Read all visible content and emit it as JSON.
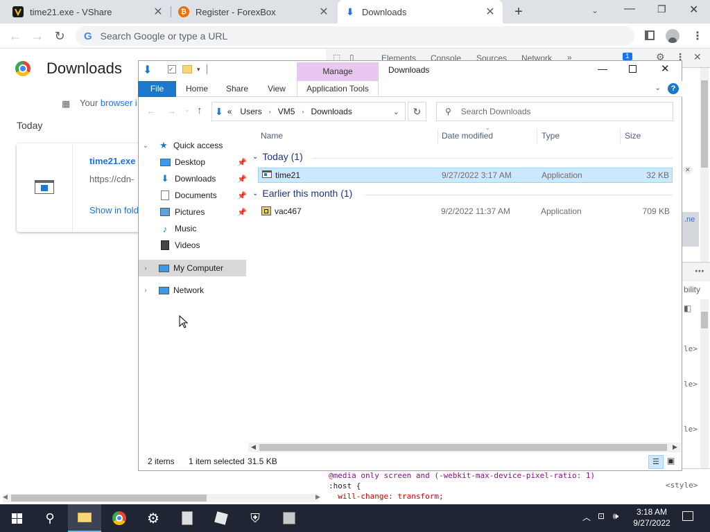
{
  "browser": {
    "tabs": [
      {
        "title": "time21.exe - VShare",
        "active": false
      },
      {
        "title": "Register - ForexBox",
        "active": false
      },
      {
        "title": "Downloads",
        "active": true
      }
    ],
    "new_tab_glyph": "+",
    "omnibox_placeholder": "Search Google or type a URL"
  },
  "downloads_page": {
    "title": "Downloads",
    "managed_prefix": "Your",
    "managed_link": "browser i",
    "today_label": "Today",
    "item": {
      "filename": "time21.exe",
      "url": "https://cdn-",
      "show_in_folder": "Show in fold"
    }
  },
  "devtools": {
    "tabs": [
      "Elements",
      "Console",
      "Sources",
      "Network"
    ],
    "more": "»",
    "issues_count": "1",
    "code_lines": [
      "@media only screen and (-webkit-max-device-pixel-ratio: 1)",
      ":host {",
      "  will-change: transform;"
    ],
    "style_tag": "<style>",
    "side_labels": [
      ".ne",
      "bility",
      "le>",
      "le>",
      "le>"
    ]
  },
  "explorer": {
    "window_title": "Downloads",
    "context_tab": "Manage",
    "ribbon_tabs": [
      "File",
      "Home",
      "Share",
      "View",
      "Application Tools"
    ],
    "address_path": [
      "«",
      "Users",
      "VM5",
      "Downloads"
    ],
    "search_placeholder": "Search Downloads",
    "nav": {
      "quick_access": "Quick access",
      "items": [
        "Desktop",
        "Downloads",
        "Documents",
        "Pictures",
        "Music",
        "Videos"
      ],
      "my_computer": "My Computer",
      "network": "Network"
    },
    "columns": [
      "Name",
      "Date modified",
      "Type",
      "Size"
    ],
    "groups": [
      {
        "label": "Today (1)",
        "files": [
          {
            "name": "time21",
            "date": "9/27/2022 3:17 AM",
            "type": "Application",
            "size": "32 KB",
            "selected": true
          }
        ]
      },
      {
        "label": "Earlier this month (1)",
        "files": [
          {
            "name": "vac467",
            "date": "9/2/2022 11:37 AM",
            "type": "Application",
            "size": "709 KB",
            "selected": false
          }
        ]
      }
    ],
    "status": {
      "item_count": "2 items",
      "selected": "1 item selected",
      "selected_size": "31.5 KB"
    }
  },
  "taskbar": {
    "time": "3:18 AM",
    "date": "9/27/2022"
  },
  "colors": {
    "accent": "#1a73e8",
    "selection": "#cce8ff",
    "manage_tab": "#e8c8f0",
    "file_tab": "#1979ca",
    "taskbar": "#1f2533"
  }
}
